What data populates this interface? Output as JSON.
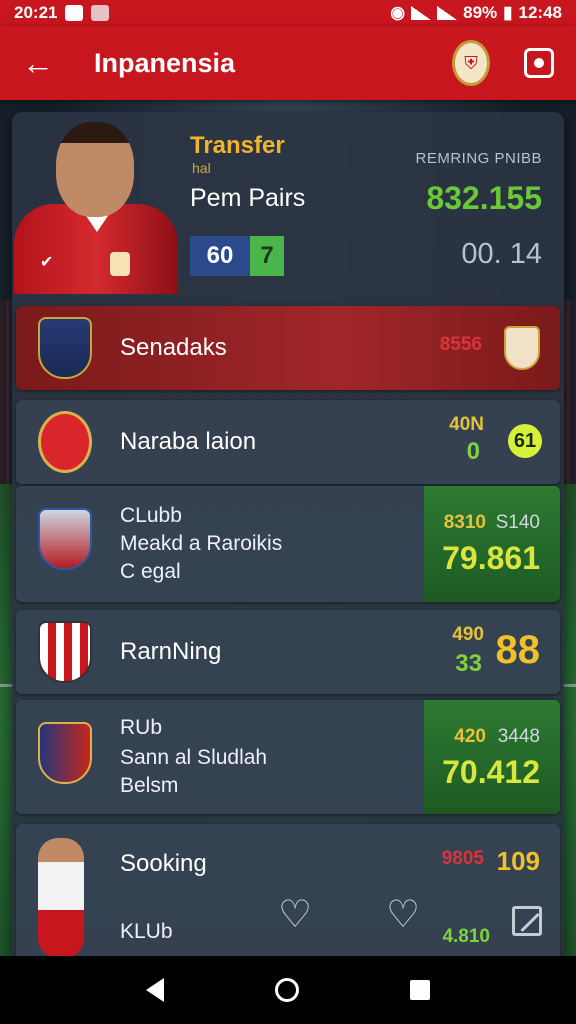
{
  "status_bar": {
    "left_time": "20:21",
    "battery": "89%",
    "clock": "12:48"
  },
  "app_bar": {
    "title": "Inpanensia"
  },
  "hero": {
    "heading": "Transfer",
    "subheading": "hal",
    "player_name": "Pem Pairs",
    "score_left": "60",
    "score_right": "7",
    "remaining_label": "REMRING PNIBB",
    "value": "832.155",
    "time": "00. 14"
  },
  "rows": [
    {
      "label": "Senadaks",
      "value": "8556"
    },
    {
      "label": "Naraba laion",
      "value_top": "40N",
      "value_bottom": "0",
      "badge": "61"
    },
    {
      "lines": [
        "CLubb",
        "Meakd a Raroikis",
        "C egal"
      ],
      "value_small_1": "8310",
      "value_small_2": "S140",
      "value_big": "79.861"
    },
    {
      "label": "RarnNing",
      "value_top": "490",
      "value_bottom": "33",
      "value_big": "88"
    },
    {
      "lines": [
        "RUb",
        "Sann al Sludlah",
        "Belsm"
      ],
      "value_small_1": "420",
      "value_small_2": "3448",
      "value_big": "70.412"
    },
    {
      "label": "Sooking",
      "value_small": "9805",
      "value_big": "109",
      "sub_label": "KLUb",
      "sub_value": "4.810"
    }
  ]
}
